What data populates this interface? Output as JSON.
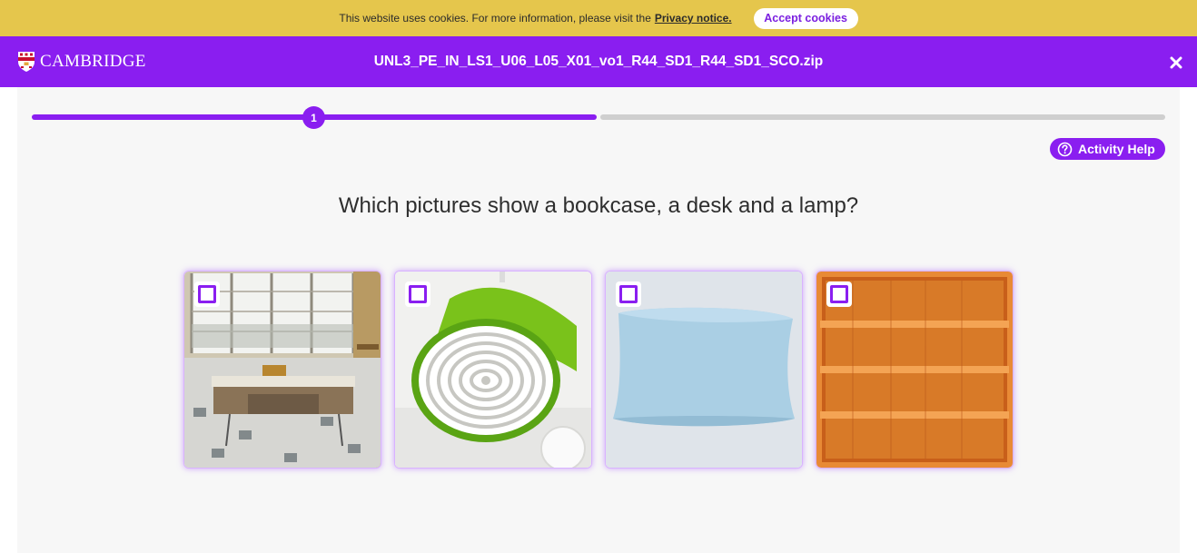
{
  "cookie_bar": {
    "message": "This website uses cookies. For more information, please visit the",
    "link_label": "Privacy notice.",
    "accept_label": "Accept cookies"
  },
  "header": {
    "logo_text": "CAMBRIDGE",
    "file_title": "UNL3_PE_IN_LS1_U06_L05_X01_vo1_R44_SD1_R44_SD1_SCO.zip",
    "close_icon": "close-icon"
  },
  "progress": {
    "current_step": "1",
    "fraction_complete": 0.5
  },
  "help": {
    "label": "Activity Help",
    "icon": "question-circle-icon"
  },
  "question": "Which pictures show a bookcase, a desk and a lamp?",
  "options": [
    {
      "subject": "desk",
      "checked": false
    },
    {
      "subject": "lamp",
      "checked": false
    },
    {
      "subject": "pillow",
      "checked": false
    },
    {
      "subject": "bookcase",
      "checked": false
    }
  ],
  "colors": {
    "brand_purple": "#8a1ef0",
    "cookie_bar": "#e5c64c",
    "panel_bg": "#f7f7f7",
    "track_inactive": "#cfcfcf"
  }
}
